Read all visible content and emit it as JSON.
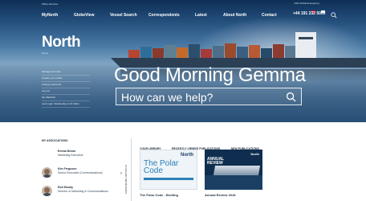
{
  "topbar": {
    "left_text": "Office Services",
    "right_text": "24hr Global Emergency",
    "flags": [
      "#c8102e",
      "#ffffff",
      "#1e3a8a"
    ]
  },
  "nav": {
    "items": [
      "MyNorth",
      "GlobeView",
      "Vessel Search",
      "Correspondents",
      "Latest",
      "About North",
      "Contact"
    ],
    "phone": "+44 191 232 5000"
  },
  "brand": {
    "logo": "North",
    "sub": "Home"
  },
  "side_menu": [
    "Manage accounts",
    "Update your profile",
    "Change password",
    "Log out",
    "My Watchlist",
    "Last Login: Wednesday at 11:30am"
  ],
  "hero": {
    "greeting": "Good Morning Gemma",
    "search_placeholder": "How can we help?"
  },
  "contacts": {
    "title": "MY ASSOCIATIONS",
    "vertical_label": "SHOW MORE CONTACTS",
    "people": [
      {
        "name": "Emma Brown",
        "role": "Marketing Executive",
        "avatar": "blank"
      },
      {
        "name": "Kim Ferguson",
        "role": "Senior Executive (Communications)",
        "avatar": "photo"
      },
      {
        "name": "Rod Moody",
        "role": "Director of Marketing & Communications",
        "avatar": "photo"
      }
    ]
  },
  "library": {
    "tabs": [
      "YOUR LIBRARY",
      "RECENTLY VIEWED PUBLICATIONS",
      "NEW PUBLICATIONS"
    ],
    "publications": [
      {
        "cover_logo": "North",
        "cover_title": "The Polar Code",
        "label": "The Polar Code - Briefing"
      },
      {
        "cover_logo": "North",
        "cover_title": "ANNUAL REVIEW",
        "label": "Annual Review 2018"
      }
    ]
  },
  "colors": {
    "hero_dark": "#0e2f55",
    "accent_blue": "#2c7fb8",
    "text_dark": "#1d2b3a"
  }
}
